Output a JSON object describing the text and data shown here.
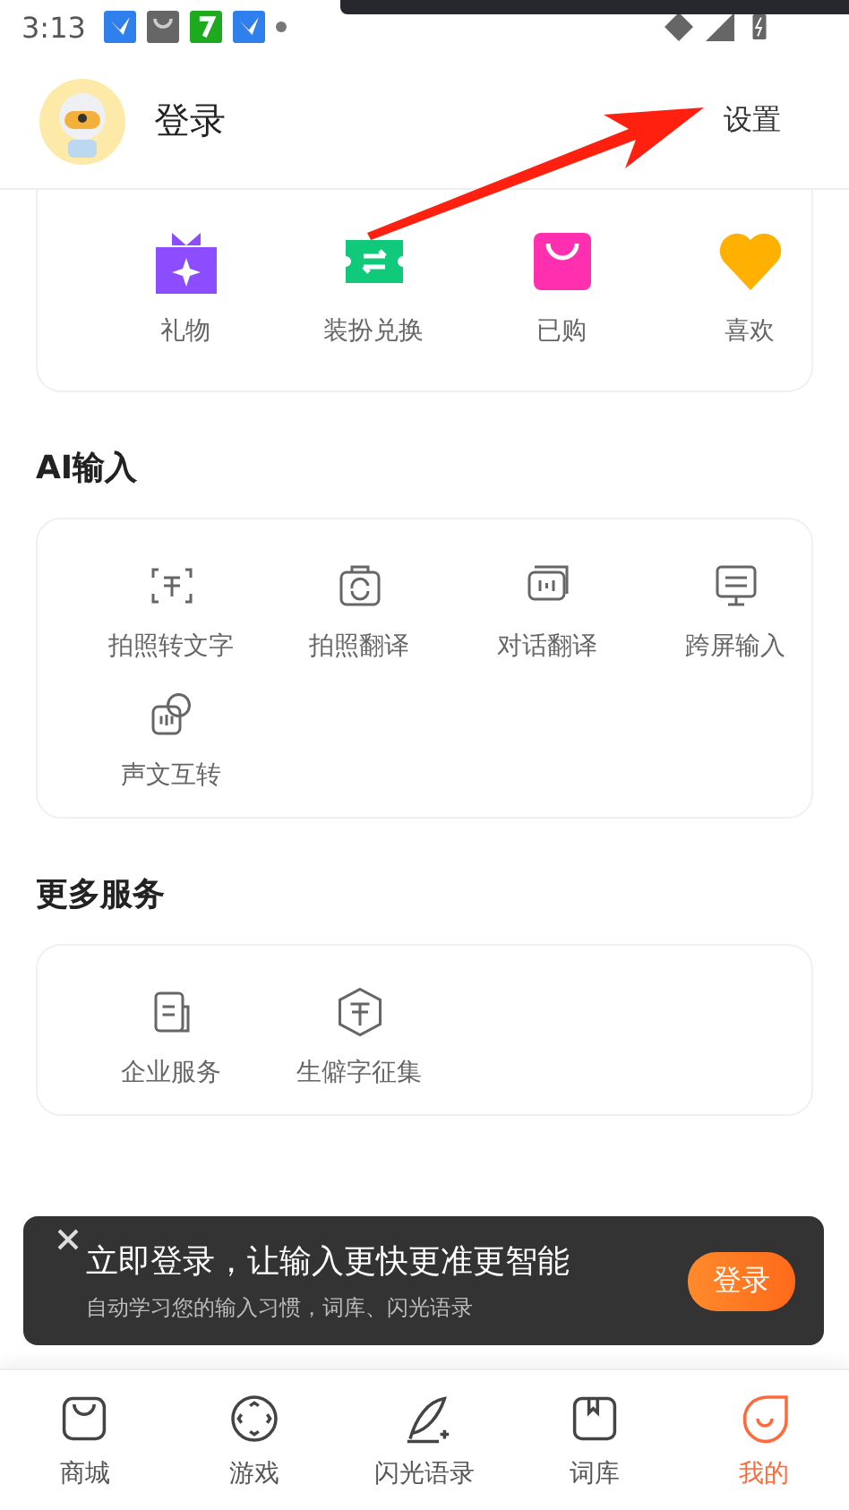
{
  "status_bar": {
    "time": "3:13"
  },
  "header": {
    "login": "登录",
    "settings": "设置"
  },
  "shortcuts": [
    {
      "label": "礼物"
    },
    {
      "label": "装扮兑换"
    },
    {
      "label": "已购"
    },
    {
      "label": "喜欢"
    }
  ],
  "sections": [
    {
      "title": "AI输入",
      "items": [
        {
          "label": "拍照转文字"
        },
        {
          "label": "拍照翻译"
        },
        {
          "label": "对话翻译"
        },
        {
          "label": "跨屏输入"
        },
        {
          "label": "声文互转"
        }
      ]
    },
    {
      "title": "更多服务",
      "items": [
        {
          "label": "企业服务"
        },
        {
          "label": "生僻字征集"
        }
      ]
    }
  ],
  "toast": {
    "title": "立即登录，让输入更快更准更智能",
    "subtitle": "自动学习您的输入习惯，词库、闪光语录",
    "button": "登录"
  },
  "bottom_nav": [
    {
      "label": "商城",
      "selected": false
    },
    {
      "label": "游戏",
      "selected": false
    },
    {
      "label": "闪光语录",
      "selected": false
    },
    {
      "label": "词库",
      "selected": false
    },
    {
      "label": "我的",
      "selected": true
    }
  ]
}
